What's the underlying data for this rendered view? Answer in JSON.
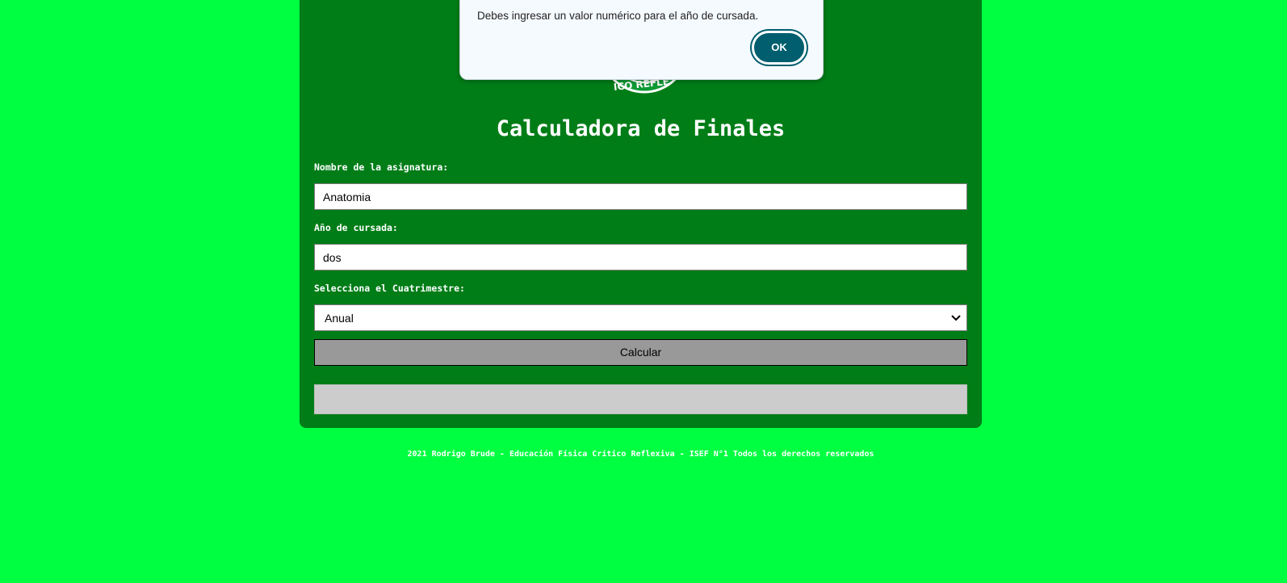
{
  "logo_text": "ICO REFLE",
  "form": {
    "title": "Calculadora de Finales",
    "subject_label": "Nombre de la asignatura:",
    "subject_value": "Anatomia",
    "year_label": "Año de cursada:",
    "year_value": "dos",
    "term_label": "Selecciona el Cuatrimestre:",
    "term_value": "Anual",
    "calculate_label": "Calcular",
    "result_text": ""
  },
  "footer": {
    "text": "2021 Rodrigo Brude - Educación Física Crítico Reflexiva - ISEF N°1 Todos los derechos reservados"
  },
  "dialog": {
    "message": "Debes ingresar un valor numérico para el año de cursada.",
    "ok_label": "OK"
  },
  "colors": {
    "page_background": "#00ff40",
    "card_background": "#007d17",
    "button_background": "#999999",
    "result_background": "#cccccc",
    "dialog_button": "#005e6e"
  }
}
